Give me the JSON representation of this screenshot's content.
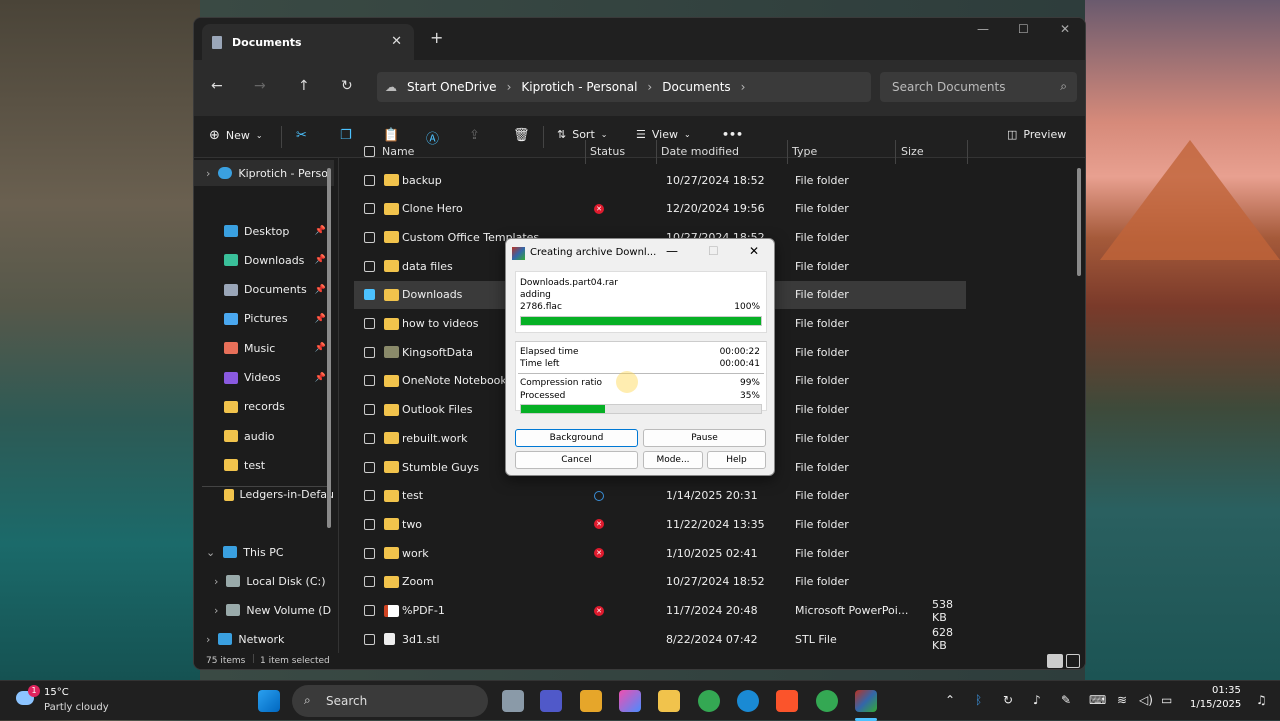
{
  "window": {
    "tab_title": "Documents",
    "new_tab": "+",
    "breadcrumbs": [
      "Start OneDrive",
      "Kiprotich - Personal",
      "Documents"
    ],
    "search_placeholder": "Search Documents"
  },
  "toolbar": {
    "new_label": "New",
    "sort_label": "Sort",
    "view_label": "View",
    "more_label": "•••",
    "preview_label": "Preview"
  },
  "sidebar": {
    "top_item": "Kiprotich - Perso",
    "quick": [
      {
        "label": "Desktop",
        "color": "#3aa0e0",
        "pinned": true
      },
      {
        "label": "Downloads",
        "color": "#3ac09a",
        "pinned": true
      },
      {
        "label": "Documents",
        "color": "#9aa6b8",
        "pinned": true
      },
      {
        "label": "Pictures",
        "color": "#4aa8f0",
        "pinned": true
      },
      {
        "label": "Music",
        "color": "#e8705a",
        "pinned": true
      },
      {
        "label": "Videos",
        "color": "#8a5ae0",
        "pinned": true
      },
      {
        "label": "records",
        "color": "#f1c34c",
        "pinned": false
      },
      {
        "label": "audio",
        "color": "#f1c34c",
        "pinned": false
      },
      {
        "label": "test",
        "color": "#f1c34c",
        "pinned": false
      },
      {
        "label": "Ledgers-in-Defau",
        "color": "#f1c34c",
        "pinned": false
      }
    ],
    "this_pc": "This PC",
    "local_disk": "Local Disk (C:)",
    "new_volume": "New Volume (D",
    "network": "Network"
  },
  "columns": {
    "name": "Name",
    "status": "Status",
    "date": "Date modified",
    "type": "Type",
    "size": "Size"
  },
  "rows": [
    {
      "name": "backup",
      "status": "",
      "date": "10/27/2024 18:52",
      "type": "File folder",
      "size": ""
    },
    {
      "name": "Clone Hero",
      "status": "error",
      "date": "12/20/2024 19:56",
      "type": "File folder",
      "size": ""
    },
    {
      "name": "Custom Office Templates",
      "status": "",
      "date": "10/27/2024 18:52",
      "type": "File folder",
      "size": ""
    },
    {
      "name": "data files",
      "status": "",
      "date": "",
      "type": "File folder",
      "size": ""
    },
    {
      "name": "Downloads",
      "status": "",
      "date": "",
      "type": "File folder",
      "size": "",
      "selected": true
    },
    {
      "name": "how to videos",
      "status": "",
      "date": "",
      "type": "File folder",
      "size": ""
    },
    {
      "name": "KingsoftData",
      "status": "",
      "date": "",
      "type": "File folder",
      "size": ""
    },
    {
      "name": "OneNote Notebooks",
      "status": "",
      "date": "",
      "type": "File folder",
      "size": ""
    },
    {
      "name": "Outlook Files",
      "status": "",
      "date": "",
      "type": "File folder",
      "size": ""
    },
    {
      "name": "rebuilt.work",
      "status": "",
      "date": "",
      "type": "File folder",
      "size": ""
    },
    {
      "name": "Stumble Guys",
      "status": "",
      "date": "",
      "type": "File folder",
      "size": ""
    },
    {
      "name": "test",
      "status": "sync",
      "date": "1/14/2025 20:31",
      "type": "File folder",
      "size": ""
    },
    {
      "name": "two",
      "status": "error",
      "date": "11/22/2024 13:35",
      "type": "File folder",
      "size": ""
    },
    {
      "name": "work",
      "status": "error",
      "date": "1/10/2025 02:41",
      "type": "File folder",
      "size": ""
    },
    {
      "name": "Zoom",
      "status": "",
      "date": "10/27/2024 18:52",
      "type": "File folder",
      "size": ""
    },
    {
      "name": "%PDF-1",
      "status": "error",
      "date": "11/7/2024 20:48",
      "type": "Microsoft PowerPoi...",
      "size": "538 KB",
      "file": "ppt"
    },
    {
      "name": "3d1.stl",
      "status": "",
      "date": "8/22/2024 07:42",
      "type": "STL File",
      "size": "628 KB",
      "file": "stl"
    }
  ],
  "statusbar": {
    "count": "75 items",
    "selected": "1 item selected"
  },
  "dialog": {
    "title": "Creating archive Downl...",
    "archive": "Downloads.part04.rar",
    "action": "adding",
    "file": "2786.flac",
    "file_percent_label": "100%",
    "file_progress": 1.0,
    "elapsed_label": "Elapsed time",
    "elapsed": "00:00:22",
    "left_label": "Time left",
    "left": "00:00:41",
    "ratio_label": "Compression ratio",
    "ratio": "99%",
    "processed_label": "Processed",
    "processed": "35%",
    "processed_progress": 0.35,
    "btn_background": "Background",
    "btn_pause": "Pause",
    "btn_cancel": "Cancel",
    "btn_mode": "Mode...",
    "btn_help": "Help"
  },
  "taskbar": {
    "weather_temp": "15°C",
    "weather_desc": "Partly cloudy",
    "weather_badge": "1",
    "search": "Search",
    "time": "01:35",
    "date": "1/15/2025"
  }
}
